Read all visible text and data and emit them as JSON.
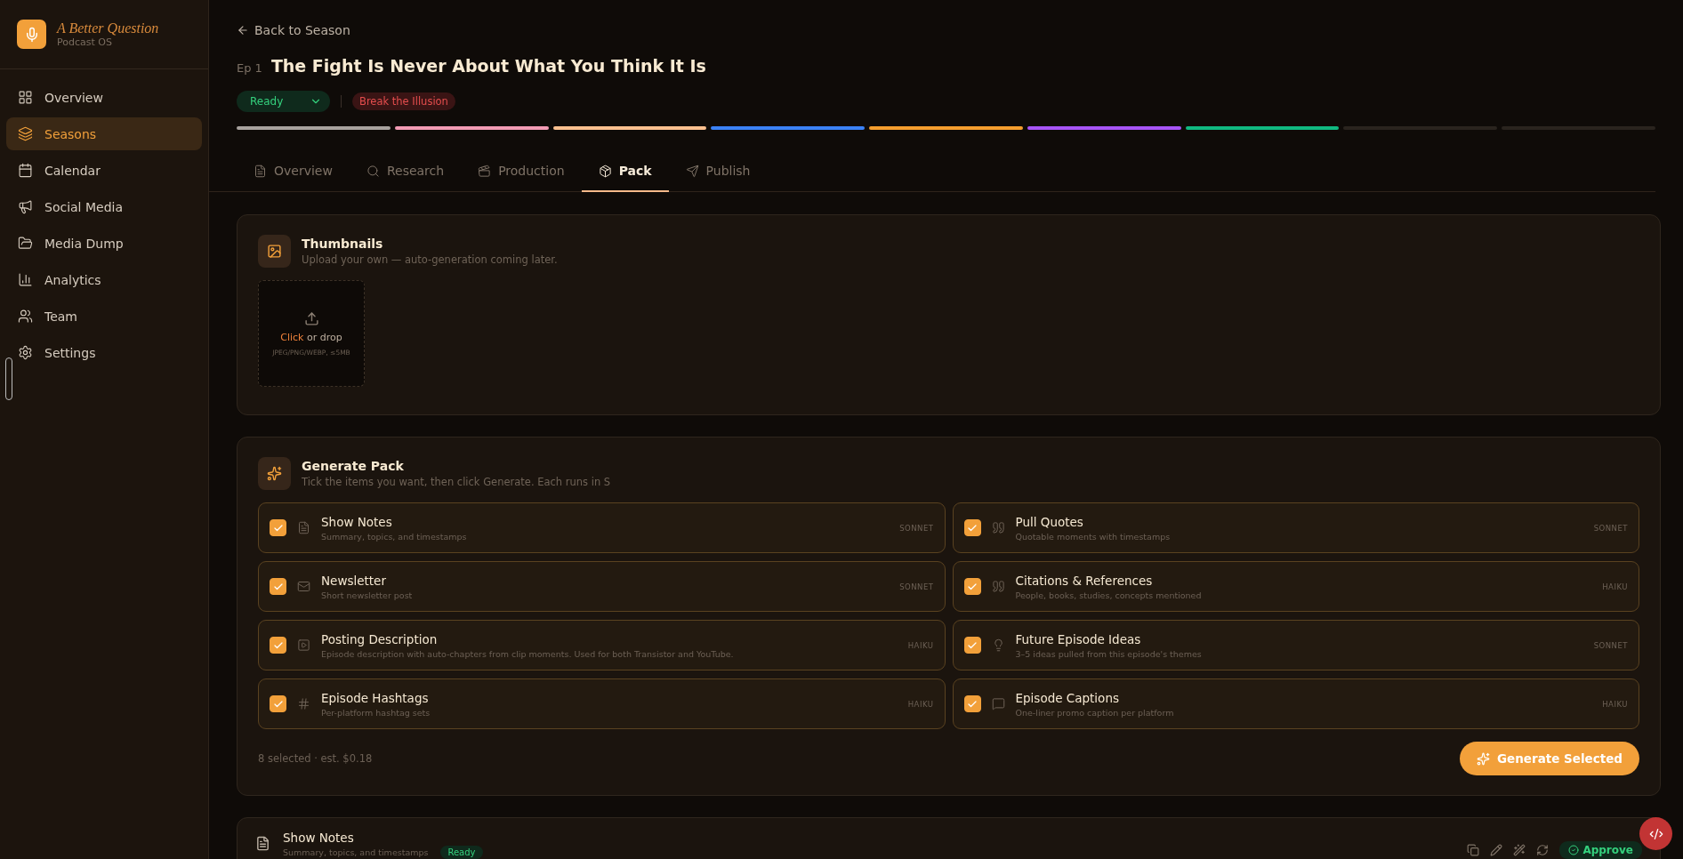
{
  "brand": {
    "name": "A Better Question",
    "subtitle": "Podcast OS"
  },
  "sidebar": {
    "items": [
      {
        "label": "Overview",
        "selected": false
      },
      {
        "label": "Seasons",
        "selected": true
      },
      {
        "label": "Calendar",
        "selected": false
      },
      {
        "label": "Social Media",
        "selected": false
      },
      {
        "label": "Media Dump",
        "selected": false
      },
      {
        "label": "Analytics",
        "selected": false
      },
      {
        "label": "Team",
        "selected": false
      },
      {
        "label": "Settings",
        "selected": false
      }
    ]
  },
  "header": {
    "back_link": "Back to Season",
    "episode_number": "Ep 1",
    "title": "The Fight Is Never About What You Think It Is",
    "status": "Ready",
    "tag": "Break the Illusion"
  },
  "stages": [
    {
      "done": true,
      "color": "#a8a29e"
    },
    {
      "done": true,
      "color": "#f29bb4"
    },
    {
      "done": true,
      "color": "#fbc08f"
    },
    {
      "done": true,
      "color": "#3b82f6"
    },
    {
      "done": true,
      "color": "#f59e2e"
    },
    {
      "done": true,
      "color": "#a855f7"
    },
    {
      "done": true,
      "color": "#10b981"
    },
    {
      "done": false
    },
    {
      "done": false
    }
  ],
  "tabs": [
    {
      "label": "Overview",
      "selected": false
    },
    {
      "label": "Research",
      "selected": false
    },
    {
      "label": "Production",
      "selected": false
    },
    {
      "label": "Pack",
      "selected": true
    },
    {
      "label": "Publish",
      "selected": false
    }
  ],
  "thumbnails": {
    "title": "Thumbnails",
    "description": "Upload your own — auto-generation coming later.",
    "upload": {
      "action": "Click",
      "rest": "or drop",
      "hint": "JPEG/PNG/WEBP, ≤5MB"
    }
  },
  "generate_pack": {
    "title": "Generate Pack",
    "description": "Tick the items you want, then click Generate. Each runs in S",
    "items": [
      {
        "title": "Show Notes",
        "description": "Summary, topics, and timestamps",
        "model": "SONNET",
        "checked": true
      },
      {
        "title": "Pull Quotes",
        "description": "Quotable moments with timestamps",
        "model": "SONNET",
        "checked": true
      },
      {
        "title": "Newsletter",
        "description": "Short newsletter post",
        "model": "SONNET",
        "checked": true
      },
      {
        "title": "Citations & References",
        "description": "People, books, studies, concepts mentioned",
        "model": "HAIKU",
        "checked": true
      },
      {
        "title": "Posting Description",
        "description": "Episode description with auto-chapters from clip moments. Used for both Transistor and YouTube.",
        "model": "HAIKU",
        "checked": true
      },
      {
        "title": "Future Episode Ideas",
        "description": "3–5 ideas pulled from this episode's themes",
        "model": "SONNET",
        "checked": true
      },
      {
        "title": "Episode Hashtags",
        "description": "Per-platform hashtag sets",
        "model": "HAIKU",
        "checked": true
      },
      {
        "title": "Episode Captions",
        "description": "One-liner promo caption per platform",
        "model": "HAIKU",
        "checked": true
      }
    ],
    "summary": "8 selected · est. $0.18",
    "button": "Generate Selected"
  },
  "output_card": {
    "title": "Show Notes",
    "description": "Summary, topics, and timestamps",
    "status": "Ready",
    "approve": "Approve"
  }
}
